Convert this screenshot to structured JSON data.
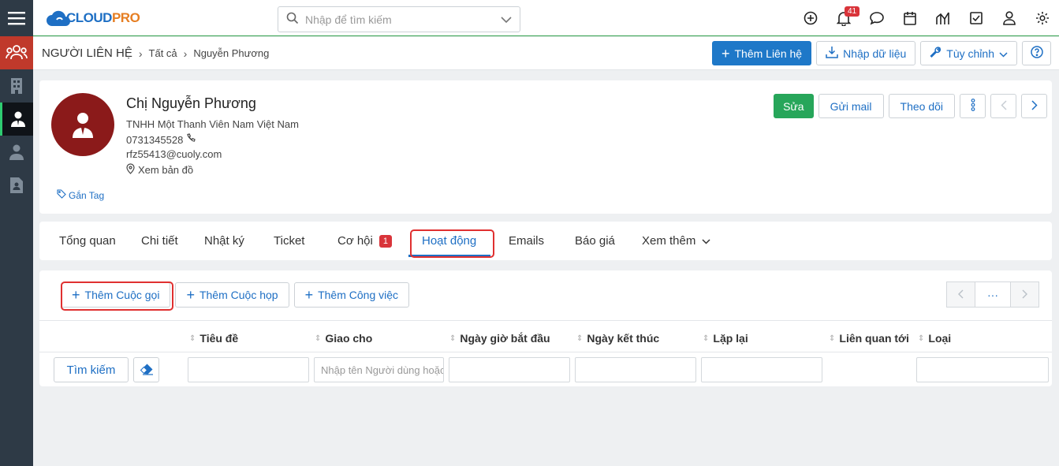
{
  "app": {
    "logo_text_a": "CLOUD",
    "logo_text_b": "PRO"
  },
  "search": {
    "placeholder": "Nhập để tìm kiếm"
  },
  "topbar": {
    "notification_count": "41"
  },
  "breadcrumb": {
    "module": "NGƯỜI LIÊN HỆ",
    "filter": "Tất cả",
    "record": "Nguyễn Phương"
  },
  "subhead_buttons": {
    "add": "Thêm Liên hệ",
    "import": "Nhập dữ liệu",
    "customize": "Tùy chỉnh"
  },
  "profile": {
    "name": "Chị Nguyễn Phương",
    "company": "TNHH Một Thanh Viên Nam Việt Nam",
    "phone": "0731345528",
    "email": "rfz55413@cuoly.com",
    "map": "Xem bản đồ",
    "tag": "Gắn Tag"
  },
  "card_buttons": {
    "edit": "Sửa",
    "send_mail": "Gửi mail",
    "follow": "Theo dõi"
  },
  "tabs": [
    {
      "label": "Tổng quan"
    },
    {
      "label": "Chi tiết"
    },
    {
      "label": "Nhật ký"
    },
    {
      "label": "Ticket"
    },
    {
      "label": "Cơ hội",
      "badge": "1"
    },
    {
      "label": "Hoạt động"
    },
    {
      "label": "Emails"
    },
    {
      "label": "Báo giá"
    },
    {
      "label": "Xem thêm"
    }
  ],
  "activity": {
    "add_call": "Thêm Cuộc gọi",
    "add_meeting": "Thêm Cuộc họp",
    "add_task": "Thêm Công việc",
    "pager_more": "···"
  },
  "table": {
    "columns": [
      "Tiêu đề",
      "Giao cho",
      "Ngày giờ bắt đầu",
      "Ngày kết thúc",
      "Lặp lại",
      "Liên quan tới",
      "Loại"
    ],
    "search_button": "Tìm kiếm",
    "assignee_placeholder": "Nhập tên Người dùng hoặc"
  },
  "colors": {
    "primary": "#1e78c8",
    "success": "#27a65a",
    "danger": "#d9343a",
    "rail": "#2e3a46"
  }
}
